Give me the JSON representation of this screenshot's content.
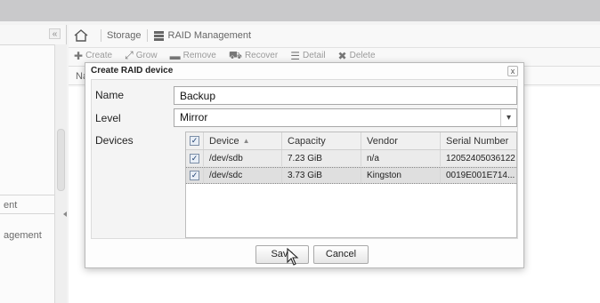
{
  "breadcrumb": {
    "home_icon": "home-icon",
    "storage": "Storage",
    "raid_icon": "database-icon",
    "raid_management": "RAID Management"
  },
  "toolbar": {
    "create": "Create",
    "grow": "Grow",
    "remove": "Remove",
    "recover": "Recover",
    "detail": "Detail",
    "delete": "Delete"
  },
  "list": {
    "first_column_header": "Na"
  },
  "sidebar": {
    "collapse_glyph": "«",
    "item_a": "ent",
    "item_b": "agement"
  },
  "dialog": {
    "title": "Create RAID device",
    "close_glyph": "x",
    "name_label": "Name",
    "name_value": "Backup",
    "level_label": "Level",
    "level_value": "Mirror",
    "devices_label": "Devices",
    "columns": {
      "device": "Device",
      "capacity": "Capacity",
      "vendor": "Vendor",
      "serial": "Serial Number"
    },
    "rows": [
      {
        "checked": true,
        "device": "/dev/sdb",
        "capacity": "7.23 GiB",
        "vendor": "n/a",
        "serial": "12052405036122"
      },
      {
        "checked": true,
        "device": "/dev/sdc",
        "capacity": "3.73 GiB",
        "vendor": "Kingston",
        "serial": "0019E001E714..."
      }
    ],
    "save_label": "Save",
    "cancel_label": "Cancel"
  },
  "colors": {
    "top_strip": "#c9c9cb",
    "dialog_background": "#fdfdfd",
    "selected_row": "#dfdfdf"
  }
}
